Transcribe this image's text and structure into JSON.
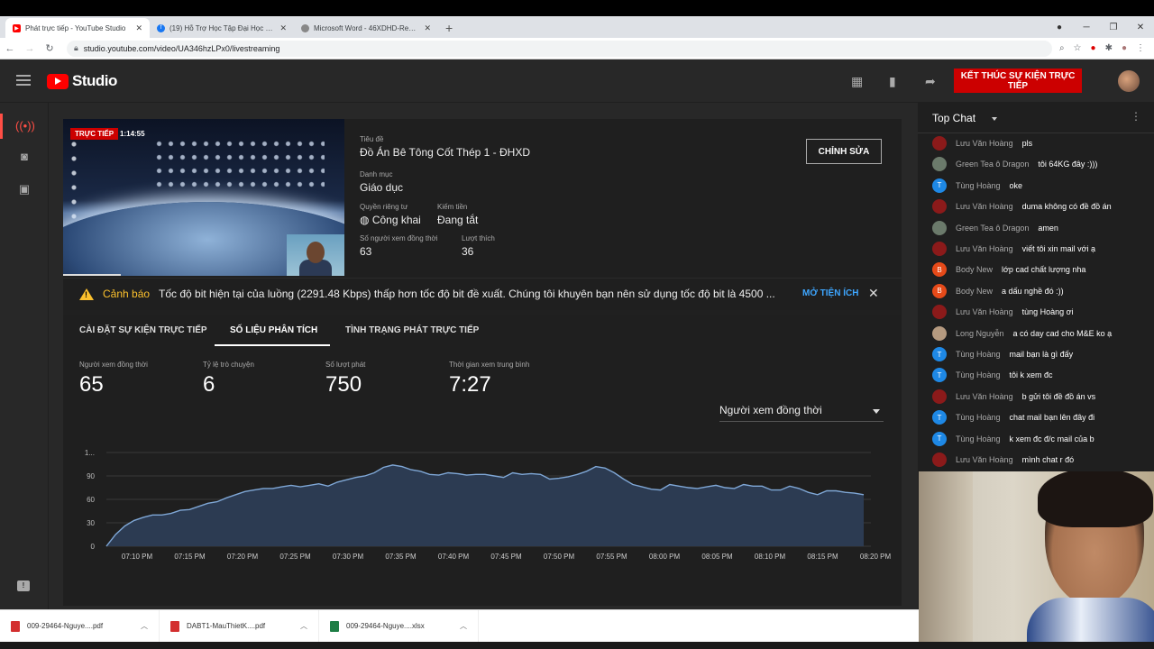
{
  "browser": {
    "tabs": [
      {
        "title": "Phát trực tiếp - YouTube Studio",
        "active": true,
        "color": "#ff0000"
      },
      {
        "title": "(19) Hỗ Trợ Học Tập Đại Học Xây...",
        "active": false,
        "color": "#1877f2"
      },
      {
        "title": "Microsoft Word - 46XDHD-Requ...",
        "active": false,
        "color": "#777777"
      }
    ],
    "url": "studio.youtube.com/video/UA346hzLPx0/livestreaming"
  },
  "header": {
    "logo_text": "Studio",
    "end_button": "KẾT THÚC SỰ KIỆN TRỰC TIẾP"
  },
  "stream": {
    "live_badge": "TRỰC TIẾP",
    "live_time": "1:14:55",
    "title_label": "Tiêu đề",
    "title": "Đồ Án Bê Tông Cốt Thép 1 - ĐHXD",
    "category_label": "Danh mục",
    "category": "Giáo dục",
    "privacy_label": "Quyền riêng tư",
    "privacy": "Công khai",
    "monetize_label": "Kiếm tiền",
    "monetize": "Đang tắt",
    "viewers_label": "Số người xem đồng thời",
    "viewers": "63",
    "likes_label": "Lượt thích",
    "likes": "36",
    "edit_button": "CHỈNH SỬA"
  },
  "warning": {
    "label": "Cảnh báo",
    "text": "Tốc độ bit hiện tại của luồng (2291.48 Kbps) thấp hơn tốc độ bit đề xuất. Chúng tôi khuyên bạn nên sử dụng tốc độ bit là 4500 ...",
    "link": "MỞ TIỆN ÍCH",
    "close": "✕"
  },
  "tabs": [
    "CÀI ĐẶT SỰ KIỆN TRỰC TIẾP",
    "SỐ LIỆU PHÂN TÍCH",
    "TÌNH TRẠNG PHÁT TRỰC TIẾP"
  ],
  "metrics": [
    {
      "label": "Người xem đồng thời",
      "value": "65"
    },
    {
      "label": "Tỷ lệ trò chuyện",
      "value": "6"
    },
    {
      "label": "Số lượt phát",
      "value": "750"
    },
    {
      "label": "Thời gian xem trung bình",
      "value": "7:27"
    }
  ],
  "metric_select": "Người xem đồng thời",
  "chart_data": {
    "type": "area",
    "ylabel": "",
    "xlabel": "",
    "ylim": [
      0,
      120
    ],
    "y_ticks": [
      "0",
      "30",
      "60",
      "90",
      "1..."
    ],
    "y_tick_values": [
      0,
      30,
      60,
      90,
      120
    ],
    "x_ticks": [
      "07:10 PM",
      "07:15 PM",
      "07:20 PM",
      "07:25 PM",
      "07:30 PM",
      "07:35 PM",
      "07:40 PM",
      "07:45 PM",
      "07:50 PM",
      "07:55 PM",
      "08:00 PM",
      "08:05 PM",
      "08:10 PM",
      "08:15 PM",
      "08:20 PM"
    ],
    "series": [
      {
        "color": "#3ea6ff",
        "values": [
          0,
          15,
          26,
          33,
          37,
          40,
          40,
          42,
          46,
          47,
          51,
          55,
          57,
          62,
          66,
          70,
          72,
          74,
          74,
          76,
          78,
          76,
          78,
          80,
          77,
          82,
          85,
          88,
          90,
          94,
          101,
          104,
          102,
          98,
          96,
          92,
          91,
          94,
          93,
          91,
          92,
          92,
          90,
          88,
          94,
          92,
          93,
          92,
          86,
          87,
          89,
          92,
          96,
          102,
          100,
          94,
          86,
          79,
          76,
          73,
          72,
          79,
          77,
          75,
          74,
          76,
          78,
          75,
          74,
          79,
          77,
          77,
          72,
          72,
          77,
          74,
          69,
          66,
          71,
          71,
          69,
          68,
          66
        ]
      }
    ],
    "x_range_minutes": [
      0,
      72
    ],
    "grid": true
  },
  "chat": {
    "mode": "Top Chat",
    "messages": [
      {
        "author": "Lưu Văn Hoàng",
        "text": "pls",
        "avatar": "",
        "color": "#8b1a1a"
      },
      {
        "author": "Green Tea ô Dragon",
        "text": "tôi 64KG đây :)))",
        "avatar": "",
        "color": "#6b7a6b"
      },
      {
        "author": "Tùng Hoàng",
        "text": "oke",
        "avatar": "T",
        "color": "#1e88e5"
      },
      {
        "author": "Lưu Văn Hoàng",
        "text": "duma không có đề đồ án",
        "avatar": "",
        "color": "#8b1a1a"
      },
      {
        "author": "Green Tea ô Dragon",
        "text": "amen",
        "avatar": "",
        "color": "#6b7a6b"
      },
      {
        "author": "Lưu Văn Hoàng",
        "text": "viết tôi xin mail với ạ",
        "avatar": "",
        "color": "#8b1a1a"
      },
      {
        "author": "Body New",
        "text": "lớp cad chất lượng nha",
        "avatar": "B",
        "color": "#e64a19"
      },
      {
        "author": "Body New",
        "text": "a dấu nghề đó :))",
        "avatar": "B",
        "color": "#e64a19"
      },
      {
        "author": "Lưu Văn Hoàng",
        "text": "tùng Hoàng ơi",
        "avatar": "",
        "color": "#8b1a1a"
      },
      {
        "author": "Long Nguyễn",
        "text": "a có day cad cho M&E ko ạ",
        "avatar": "",
        "color": "#b59a80"
      },
      {
        "author": "Tùng Hoàng",
        "text": "mail bạn là gì đấy",
        "avatar": "T",
        "color": "#1e88e5"
      },
      {
        "author": "Tùng Hoàng",
        "text": "tôi k xem đc",
        "avatar": "T",
        "color": "#1e88e5"
      },
      {
        "author": "Lưu Văn Hoàng",
        "text": "b gửi tôi đề đồ án vs",
        "avatar": "",
        "color": "#8b1a1a"
      },
      {
        "author": "Tùng Hoàng",
        "text": "chat mail bạn lên đây đi",
        "avatar": "T",
        "color": "#1e88e5"
      },
      {
        "author": "Tùng Hoàng",
        "text": "k xem đc đ/c mail của b",
        "avatar": "T",
        "color": "#1e88e5"
      },
      {
        "author": "Lưu Văn Hoàng",
        "text": "mình chat r đó",
        "avatar": "",
        "color": "#8b1a1a"
      }
    ]
  },
  "downloads": [
    {
      "name": "009-29464-Nguye....pdf",
      "type": "pdf"
    },
    {
      "name": "DABT1-MauThietK....pdf",
      "type": "pdf"
    },
    {
      "name": "009-29464-Nguye....xlsx",
      "type": "xlsx"
    }
  ],
  "colors": {
    "accent": "#cc0000",
    "warning": "#fbc02d",
    "link": "#3ea6ff"
  }
}
